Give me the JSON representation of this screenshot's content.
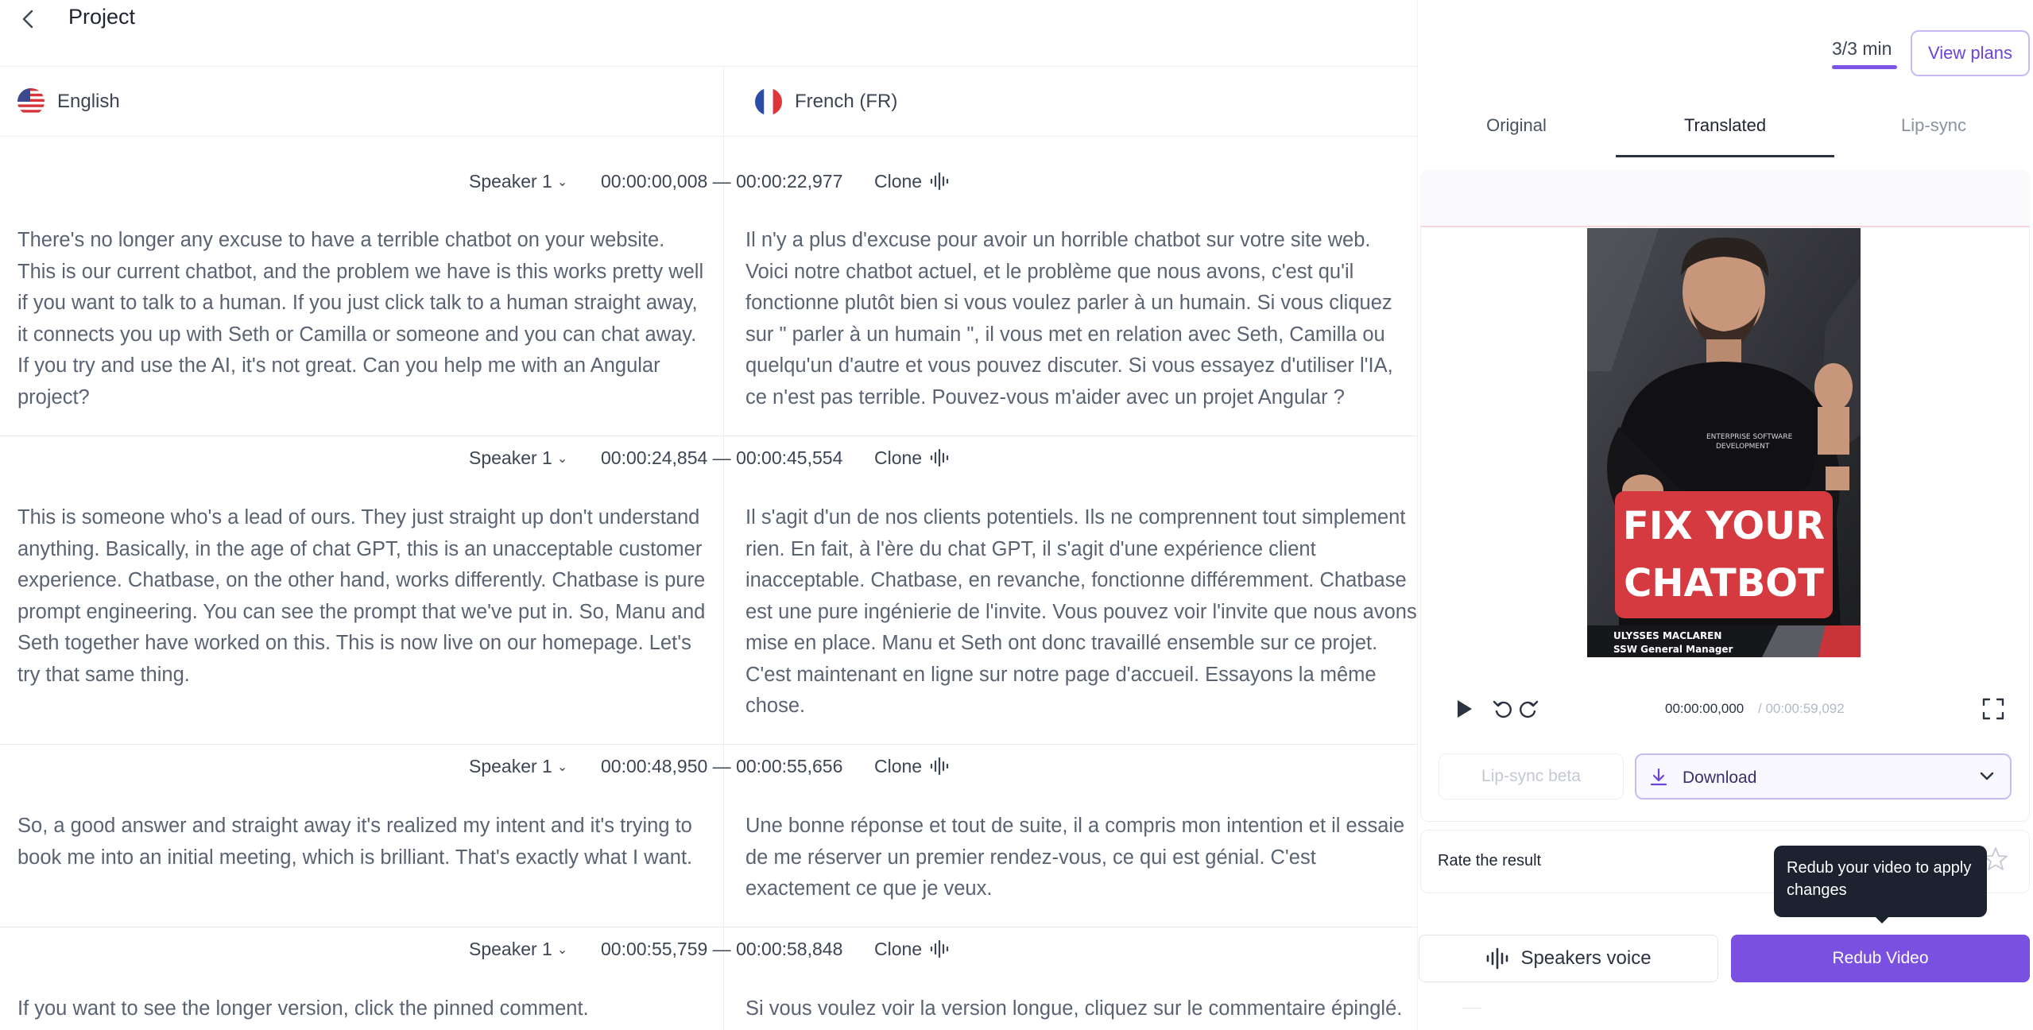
{
  "header": {
    "title": "Project"
  },
  "languages": {
    "source": "English",
    "target": "French (FR)"
  },
  "segments": [
    {
      "speaker": "Speaker 1",
      "timecode": "00:00:00,008 — 00:00:22,977",
      "clone_label": "Clone",
      "source_text": "There's no longer any excuse to have a terrible chatbot on your website. This is our current chatbot, and the problem we have is this works pretty well if you want to talk to a human. If you just click talk to a human straight away, it connects you up with Seth or Camilla or someone and you can chat away. If you try and use the AI, it's not great. Can you help me with an Angular project?",
      "target_text": "Il n'y a plus d'excuse pour avoir un horrible chatbot sur votre site web. Voici notre chatbot actuel, et le problème que nous avons, c'est qu'il fonctionne plutôt bien si vous voulez parler à un humain. Si vous cliquez sur \" parler à un humain \", il vous met en relation avec Seth, Camilla ou quelqu'un d'autre et vous pouvez discuter. Si vous essayez d'utiliser l'IA, ce n'est pas terrible. Pouvez-vous m'aider avec un projet Angular ?"
    },
    {
      "speaker": "Speaker 1",
      "timecode": "00:00:24,854 — 00:00:45,554",
      "clone_label": "Clone",
      "source_text": "This is someone who's a lead of ours. They just straight up don't understand anything. Basically, in the age of chat GPT, this is an unacceptable customer experience. Chatbase, on the other hand, works differently. Chatbase is pure prompt engineering. You can see the prompt that we've put in. So, Manu and Seth together have worked on this. This is now live on our homepage. Let's try that same thing.",
      "target_text": "Il s'agit d'un de nos clients potentiels. Ils ne comprennent tout simplement rien. En fait, à l'ère du chat GPT, il s'agit d'une expérience client inacceptable. Chatbase, en revanche, fonctionne différemment. Chatbase est une pure ingénierie de l'invite. Vous pouvez voir l'invite que nous avons mise en place. Manu et Seth ont donc travaillé ensemble sur ce projet. C'est maintenant en ligne sur notre page d'accueil. Essayons la même chose."
    },
    {
      "speaker": "Speaker 1",
      "timecode": "00:00:48,950 — 00:00:55,656",
      "clone_label": "Clone",
      "source_text": "So, a good answer and straight away it's realized my intent and it's trying to book me into an initial meeting, which is brilliant. That's exactly what I want.",
      "target_text": "Une bonne réponse et tout de suite, il a compris mon intention et il essaie de me réserver un premier rendez-vous, ce qui est génial. C'est exactement ce que je veux."
    },
    {
      "speaker": "Speaker 1",
      "timecode": "00:00:55,759 — 00:00:58,848",
      "clone_label": "Clone",
      "source_text": "If you want to see the longer version, click the pinned comment.",
      "target_text": "Si vous voulez voir la version longue, cliquez sur le commentaire épinglé."
    }
  ],
  "right_panel": {
    "usage": "3/3 min",
    "view_plans": "View plans",
    "tabs": [
      "Original",
      "Translated",
      "Lip-sync"
    ],
    "active_tab": "Translated",
    "video": {
      "overlay_line1": "FIX YOUR",
      "overlay_line2": "CHATBOT",
      "presenter_name": "ULYSSES MACLAREN",
      "presenter_role": "SSW General Manager"
    },
    "player": {
      "current_time": "00:00:00,000",
      "total_time": "/ 00:00:59,092"
    },
    "lipsync_button": "Lip-sync beta",
    "download_button": "Download",
    "rate_label": "Rate the result",
    "tooltip": "Redub your video to apply changes",
    "speakers_voice_button": "Speakers voice",
    "redub_button": "Redub Video"
  },
  "colors": {
    "accent": "#7a50e0",
    "tooltip_bg": "#1c2230",
    "text_muted": "#5a6372"
  },
  "icons": [
    "back-arrow-icon",
    "us-flag-icon",
    "fr-flag-icon",
    "chevron-down-icon",
    "waveform-icon",
    "play-icon",
    "rewind-icon",
    "forward-icon",
    "fullscreen-icon",
    "download-icon",
    "star-icon"
  ]
}
